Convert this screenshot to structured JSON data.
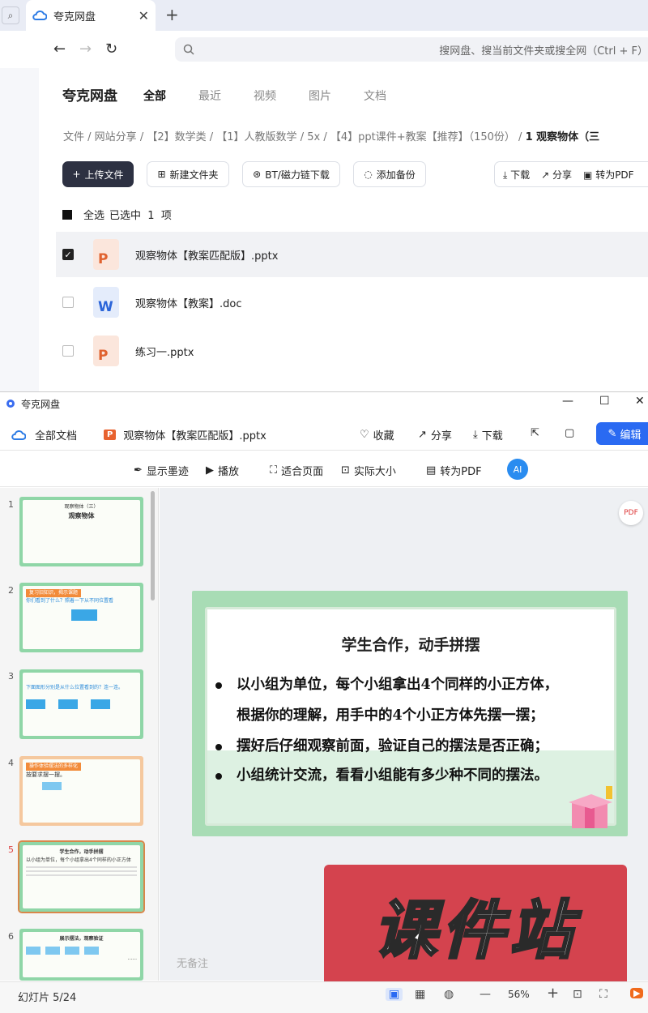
{
  "browser": {
    "tab_title": "夸克网盘",
    "address_placeholder": "搜网盘、搜当前文件夹或搜全网（Ctrl + F）"
  },
  "drive": {
    "brand": "夸克网盘",
    "nav": [
      "全部",
      "最近",
      "视频",
      "图片",
      "文档"
    ],
    "breadcrumb": [
      "文件",
      "网站分享",
      "【2】数学类",
      "【1】人教版数学",
      "5x",
      "【4】ppt课件+教案【推荐】（150份）"
    ],
    "breadcrumb_current": "1 观察物体（三",
    "toolbar": {
      "upload": "上传文件",
      "new_folder": "新建文件夹",
      "bt": "BT/磁力链下载",
      "backup": "添加备份",
      "download": "下载",
      "share": "分享",
      "convert": "转为PDF"
    },
    "select_all": "全选",
    "selected": "已选中",
    "selected_count": "1",
    "selected_unit": "项",
    "files": [
      {
        "name": "观察物体【教案匹配版】.pptx",
        "type": "P"
      },
      {
        "name": "观察物体【教案】.doc",
        "type": "W"
      },
      {
        "name": "练习一.pptx",
        "type": "P"
      }
    ]
  },
  "viewer": {
    "title": "夸克网盘",
    "all_docs": "全部文档",
    "doc_name": "观察物体【教案匹配版】.pptx",
    "favorite": "收藏",
    "share": "分享",
    "download": "下载",
    "edit": "编辑",
    "show_ink": "显示墨迹",
    "play": "播放",
    "fit_page": "适合页面",
    "actual_size": "实际大小",
    "to_pdf": "转为PDF",
    "ai": "AI",
    "thumbnails": [
      {
        "num": "1",
        "title": "观察物体",
        "sub": "观察物体（三）"
      },
      {
        "num": "2",
        "title": "复习旧知识，揭示课题",
        "sub": "你们看到了什么？照着一下从不同位置看"
      },
      {
        "num": "3",
        "title": "",
        "sub": "下面图形分别是从什么位置看到的？连一连。"
      },
      {
        "num": "4",
        "title": "操作体验摆法的多样化",
        "sub": "按要求摆一摆。"
      },
      {
        "num": "5",
        "title": "学生合作，动手拼摆",
        "sub": "以小组为单位，每个小组拿出4个同样的小正方体"
      },
      {
        "num": "6",
        "title": "展示摆法，观察验证",
        "sub": "......"
      }
    ],
    "slide": {
      "title": "学生合作，动手拼摆",
      "bullets": [
        "以小组为单位，每个小组拿出4个同样的小正方体，",
        "根据你的理解，用手中的4个小正方体先摆一摆；",
        "摆好后仔细观察前面，验证自己的摆法是否正确；",
        "小组统计交流，看看小组能有多少种不同的摆法。"
      ]
    },
    "watermark": "课件站",
    "note": "无备注",
    "slide_counter": "幻灯片 5/24",
    "zoom": "56%"
  }
}
